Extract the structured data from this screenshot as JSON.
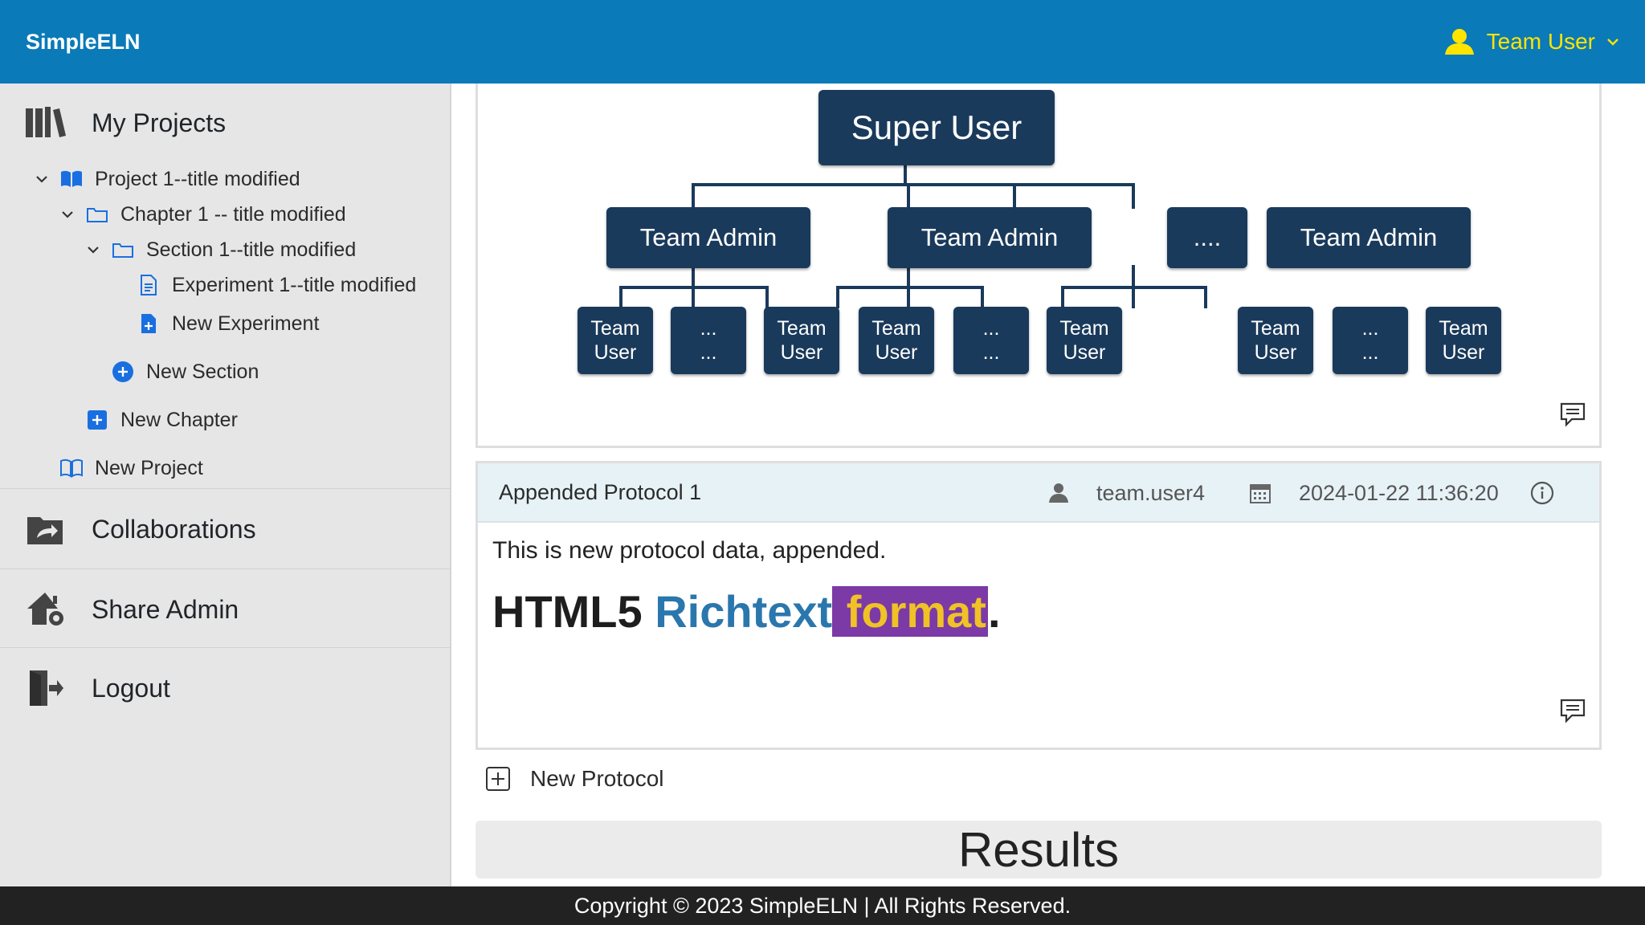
{
  "app": {
    "brand": "SimpleELN",
    "user_name": "Team User"
  },
  "sidebar": {
    "my_projects": "My Projects",
    "tree": [
      {
        "label": "Project 1--title modified"
      },
      {
        "label": "Chapter 1 -- title modified"
      },
      {
        "label": "Section 1--title modified"
      },
      {
        "label": "Experiment 1--title modified"
      },
      {
        "label": "New Experiment"
      },
      {
        "label": "New Section"
      },
      {
        "label": "New Chapter"
      },
      {
        "label": "New Project"
      }
    ],
    "collaborations": "Collaborations",
    "share_admin": "Share Admin",
    "logout": "Logout"
  },
  "diagram": {
    "super_user": "Super User",
    "team_admin": "Team Admin",
    "ellipsis_admin": "....",
    "team": "Team",
    "user": "User",
    "ellipsis_small": "..."
  },
  "protocol": {
    "title": "Appended Protocol 1",
    "author": "team.user4",
    "date": "2024-01-22 11:36:20",
    "body_text": "This is new protocol data, appended.",
    "rich_plain": "HTML5",
    "rich_blue": "Richtext",
    "rich_highlight": "format",
    "rich_end": "."
  },
  "new_protocol": "New Protocol",
  "results_title": "Results",
  "footer": "Copyright © 2023 SimpleELN | All Rights Reserved.",
  "colors": {
    "navbar": "#0a7ab8",
    "user_accent": "#ffe400",
    "sidebar_bg": "#e6e6e6",
    "tree_icon_blue": "#1a6fe0",
    "org_box": "#1a3a5b",
    "protocol_header_bg": "#e7f2f7",
    "rich_blue": "#2a77ad",
    "highlight_bg": "#7b3aa6",
    "highlight_text": "#f0c226",
    "footer_bg": "#222222"
  },
  "icons": {
    "user": "user-icon",
    "books": "books-icon",
    "collaborations": "folder-share-icon",
    "share_admin": "house-gear-icon",
    "logout": "door-exit-icon",
    "comment": "comment-icon",
    "calendar": "calendar-icon",
    "info": "info-icon"
  }
}
